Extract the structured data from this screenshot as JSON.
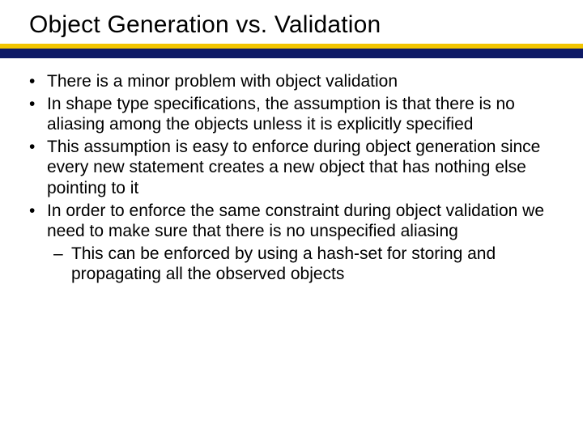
{
  "title": "Object Generation vs. Validation",
  "bullets": [
    {
      "text": "There is a minor problem with object validation",
      "sub": []
    },
    {
      "text": "In shape type specifications, the assumption is that there is no aliasing among the objects unless it is explicitly specified",
      "sub": []
    },
    {
      "text": "This assumption is easy to enforce during object generation since every new statement creates a new object that has nothing else pointing to it",
      "sub": []
    },
    {
      "text": "In order to enforce the same constraint during object validation we need to make sure that there is no unspecified aliasing",
      "sub": [
        "This can be enforced by using a hash-set for storing and propagating all the observed objects"
      ]
    }
  ]
}
